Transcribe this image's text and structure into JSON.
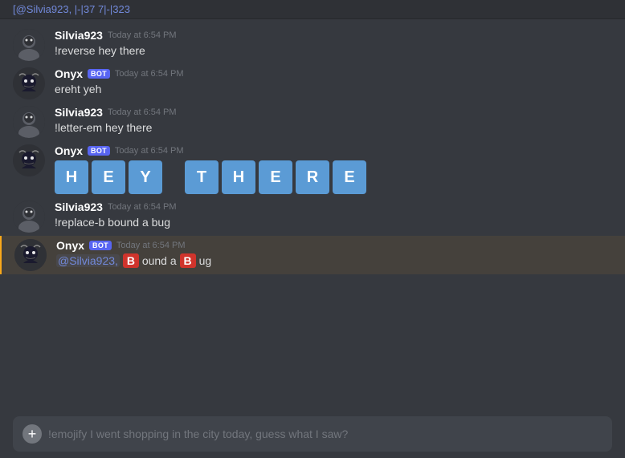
{
  "top_mention": {
    "text": "[@Silvia923, |-|37 7|-|323",
    "color": "#7289da"
  },
  "messages": [
    {
      "id": "msg1",
      "type": "user",
      "username": "Silvia923",
      "timestamp": "Today at 6:54 PM",
      "text": "!reverse hey there",
      "is_bot": false
    },
    {
      "id": "msg2",
      "type": "bot",
      "username": "Onyx",
      "timestamp": "Today at 6:54 PM",
      "text": "ereht yeh",
      "is_bot": true
    },
    {
      "id": "msg3",
      "type": "user",
      "username": "Silvia923",
      "timestamp": "Today at 6:54 PM",
      "text": "!letter-em hey there",
      "is_bot": false
    },
    {
      "id": "msg4",
      "type": "bot",
      "username": "Onyx",
      "timestamp": "Today at 6:54 PM",
      "letters": [
        "H",
        "E",
        "Y",
        "",
        "T",
        "H",
        "E",
        "R",
        "E"
      ],
      "is_bot": true
    },
    {
      "id": "msg5",
      "type": "user",
      "username": "Silvia923",
      "timestamp": "Today at 6:54 PM",
      "text": "!replace-b bound a bug",
      "is_bot": false
    },
    {
      "id": "msg6",
      "type": "bot",
      "username": "Onyx",
      "timestamp": "Today at 6:54 PM",
      "is_bot": true,
      "replace_b": true,
      "mention": "@Silvia923,",
      "before": " ",
      "word1": "B",
      "mid1": "ound a ",
      "word2": "B",
      "mid2": "ug"
    }
  ],
  "input": {
    "placeholder": "!emojify I went shopping in the city today, guess what I saw?",
    "add_button": "+"
  },
  "bot_badge": "BOT",
  "highlighted_row_id": "msg6"
}
